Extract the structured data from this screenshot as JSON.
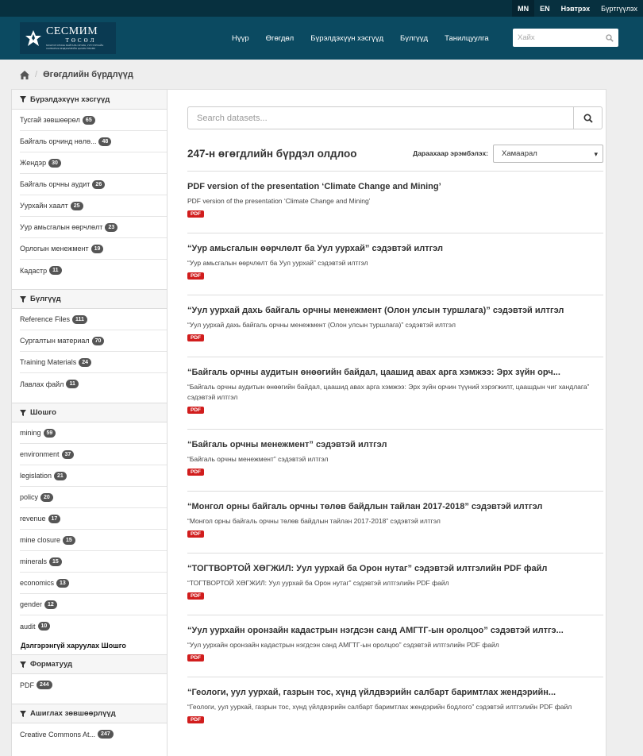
{
  "topbar": {
    "lang_mn": "MN",
    "lang_en": "EN",
    "login": "Нэвтрэх",
    "register": "Бүртгүүлэх"
  },
  "logo": {
    "name": "СЕСМИМ",
    "sub": "ТӨСӨЛ",
    "tiny": "МОНГОЛ УЛСЫН БАЙГАЛЬ ОРЧИН, УУЛ УУРХАЙН САЛБАРЫН МЭДЭЭЛЛИЙН ЦАХИМ ТӨСӨЛ"
  },
  "nav": [
    "Нүүр",
    "Өгөгдөл",
    "Бүрэлдэхүүн хэсгүүд",
    "Бүлгүүд",
    "Танилцуулга"
  ],
  "top_search": {
    "placeholder": "Хайх"
  },
  "breadcrumb": {
    "current": "Өгөгдлийн бүрдлүүд"
  },
  "facets": [
    {
      "title": "Бүрэлдэхүүн хэсгүүд",
      "items": [
        {
          "label": "Тусгай зөвшөөрөл",
          "count": "65"
        },
        {
          "label": "Байгаль орчинд нөлө...",
          "count": "48"
        },
        {
          "label": "Жендэр",
          "count": "30"
        },
        {
          "label": "Байгаль орчны аудит",
          "count": "26"
        },
        {
          "label": "Уурхайн хаалт",
          "count": "25"
        },
        {
          "label": "Уур амьсгалын өөрчлөлт",
          "count": "23"
        },
        {
          "label": "Орлогын менежмент",
          "count": "19"
        },
        {
          "label": "Кадастр",
          "count": "11"
        }
      ]
    },
    {
      "title": "Бүлгүүд",
      "items": [
        {
          "label": "Reference Files",
          "count": "111"
        },
        {
          "label": "Сургалтын материал",
          "count": "70"
        },
        {
          "label": "Training Materials",
          "count": "24"
        },
        {
          "label": "Лавлах файл",
          "count": "11"
        }
      ]
    },
    {
      "title": "Шошго",
      "items": [
        {
          "label": "mining",
          "count": "59"
        },
        {
          "label": "environment",
          "count": "37"
        },
        {
          "label": "legislation",
          "count": "21"
        },
        {
          "label": "policy",
          "count": "20"
        },
        {
          "label": "revenue",
          "count": "17"
        },
        {
          "label": "mine closure",
          "count": "15"
        },
        {
          "label": "minerals",
          "count": "15"
        },
        {
          "label": "economics",
          "count": "13"
        },
        {
          "label": "gender",
          "count": "12"
        },
        {
          "label": "audit",
          "count": "10"
        }
      ],
      "more": "Дэлгэрэнгүй харуулах Шошго"
    },
    {
      "title": "Форматууд",
      "items": [
        {
          "label": "PDF",
          "count": "244"
        }
      ]
    },
    {
      "title": "Ашиглах зөвшөөрлүүд",
      "items": [
        {
          "label": "Creative Commons At...",
          "count": "247"
        }
      ]
    }
  ],
  "search": {
    "placeholder": "Search datasets..."
  },
  "results": {
    "count_text": "247-н өгөгдлийн бүрдэл олдлоо",
    "sort_label": "Дараахаар эрэмбэлэх:",
    "sort_value": "Хамаарал"
  },
  "datasets": [
    {
      "title": "PDF version of the presentation ‘Climate Change and Mining’",
      "desc": "PDF version of the presentation ‘Climate Change and Mining’",
      "format": "PDF"
    },
    {
      "title": "“Уур амьсгалын өөрчлөлт ба Уул уурхай” сэдэвтэй илтгэл",
      "desc": "“Уур амьсгалын өөрчлөлт ба Уул уурхай” сэдэвтэй илтгэл",
      "format": "PDF"
    },
    {
      "title": "“Уул уурхай дахь байгаль орчны менежмент (Олон улсын туршлага)” сэдэвтэй илтгэл",
      "desc": "“Уул уурхай дахь байгаль орчны менежмент (Олон улсын туршлага)” сэдэвтэй илтгэл",
      "format": "PDF"
    },
    {
      "title": "“Байгаль орчны аудитын өнөөгийн байдал, цаашид авах арга хэмжээ: Эрх зүйн орч...",
      "desc": "“Байгаль орчны аудитын өнөөгийн байдал, цаашид авах арга хэмжээ: Эрх зүйн орчин түүний хэрэгжилт, цаашдын чиг хандлага” сэдэвтэй илтгэл",
      "format": "PDF"
    },
    {
      "title": "“Байгаль орчны менежмент” сэдэвтэй илтгэл",
      "desc": "“Байгаль орчны менежмент” сэдэвтэй илтгэл",
      "format": "PDF"
    },
    {
      "title": "“Монгол орны байгаль орчны төлөв байдлын тайлан 2017-2018” сэдэвтэй илтгэл",
      "desc": "“Монгол орны байгаль орчны төлөв байдлын тайлан 2017-2018” сэдэвтэй илтгэл",
      "format": "PDF"
    },
    {
      "title": "“ТОГТВОРТОЙ ХӨГЖИЛ: Уул уурхай ба Орон нутаг” сэдэвтэй илтгэлийн PDF файл",
      "desc": "“ТОГТВОРТОЙ ХӨГЖИЛ: Уул уурхай ба Орон нутаг” сэдэвтэй илтгэлийн PDF файл",
      "format": "PDF"
    },
    {
      "title": "“Уул уурхайн оронзайн кадастрын нэгдсэн санд АМГТГ-ын оролцоо” сэдэвтэй илтгэ...",
      "desc": "“Уул уурхайн оронзайн кадастрын нэгдсэн санд АМГТГ-ын оролцоо” сэдэвтэй илтгэлийн PDF файл",
      "format": "PDF"
    },
    {
      "title": "“Геологи, уул уурхай, газрын тос, хүнд үйлдвэрийн салбарт баримтлах жендэрийн...",
      "desc": "“Геологи, уул уурхай, газрын тос, хүнд үйлдвэрийн салбарт баримтлах жендэрийн бодлого” сэдэвтэй илтгэлийн PDF файл",
      "format": "PDF"
    }
  ]
}
